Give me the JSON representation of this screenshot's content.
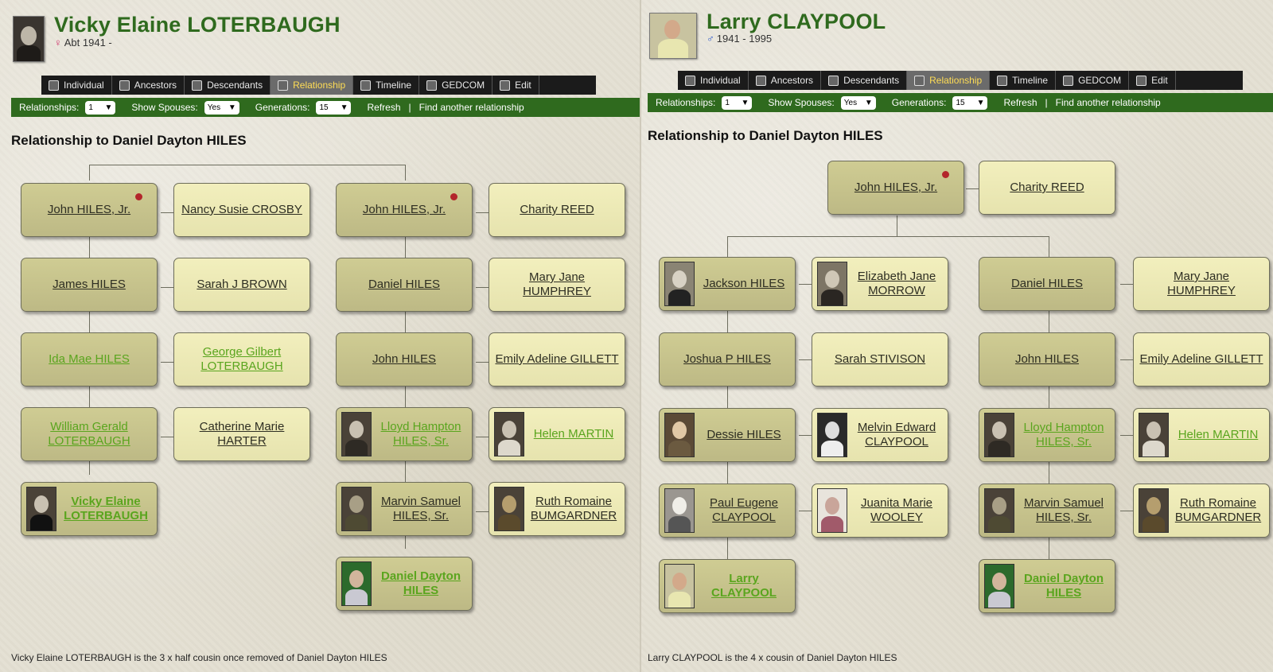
{
  "left": {
    "person": {
      "name": "Vicky Elaine LOTERBAUGH",
      "sex_symbol": "♀",
      "dates": "Abt 1941 -"
    },
    "tabs": [
      "Individual",
      "Ancestors",
      "Descendants",
      "Relationship",
      "Timeline",
      "GEDCOM",
      "Edit"
    ],
    "active_tab": "Relationship",
    "toolbar": {
      "relationships_label": "Relationships:",
      "relationships_value": "1",
      "spouses_label": "Show Spouses:",
      "spouses_value": "Yes",
      "generations_label": "Generations:",
      "generations_value": "15",
      "refresh": "Refresh",
      "separator": "|",
      "find": "Find another relationship"
    },
    "heading": "Relationship to Daniel Dayton HILES",
    "tree": {
      "col1": [
        {
          "name": "John HILES, Jr.",
          "spouse": "Nancy Susie CROSBY"
        },
        {
          "name": "James HILES",
          "spouse": "Sarah J BROWN"
        },
        {
          "name": "Ida Mae HILES",
          "spouse": "George Gilbert LOTERBAUGH"
        },
        {
          "name": "William Gerald LOTERBAUGH",
          "spouse": "Catherine Marie HARTER"
        },
        {
          "name": "Vicky Elaine LOTERBAUGH"
        }
      ],
      "col2": [
        {
          "name": "John HILES, Jr.",
          "spouse": "Charity REED"
        },
        {
          "name": "Daniel HILES",
          "spouse": "Mary Jane HUMPHREY"
        },
        {
          "name": "John HILES",
          "spouse": "Emily Adeline GILLETT"
        },
        {
          "name": "Lloyd Hampton HILES, Sr.",
          "spouse": "Helen MARTIN"
        },
        {
          "name": "Marvin Samuel HILES, Sr.",
          "spouse": "Ruth Romaine BUMGARDNER"
        },
        {
          "name": "Daniel Dayton HILES"
        }
      ]
    },
    "summary": "Vicky Elaine LOTERBAUGH is the 3 x half cousin once removed of Daniel Dayton HILES"
  },
  "right": {
    "person": {
      "name": "Larry CLAYPOOL",
      "sex_symbol": "♂",
      "dates": "1941 - 1995"
    },
    "tabs": [
      "Individual",
      "Ancestors",
      "Descendants",
      "Relationship",
      "Timeline",
      "GEDCOM",
      "Edit"
    ],
    "active_tab": "Relationship",
    "toolbar": {
      "relationships_label": "Relationships:",
      "relationships_value": "1",
      "spouses_label": "Show Spouses:",
      "spouses_value": "Yes",
      "generations_label": "Generations:",
      "generations_value": "15",
      "refresh": "Refresh",
      "separator": "|",
      "find": "Find another relationship"
    },
    "heading": "Relationship to Daniel Dayton HILES",
    "tree": {
      "top": {
        "name": "John HILES, Jr.",
        "spouse": "Charity REED"
      },
      "col1": [
        {
          "name": "Jackson HILES",
          "spouse": "Elizabeth Jane MORROW"
        },
        {
          "name": "Joshua P HILES",
          "spouse": "Sarah STIVISON"
        },
        {
          "name": "Dessie HILES",
          "spouse": "Melvin Edward CLAYPOOL"
        },
        {
          "name": "Paul Eugene CLAYPOOL",
          "spouse": "Juanita Marie WOOLEY"
        },
        {
          "name": "Larry CLAYPOOL"
        }
      ],
      "col2": [
        {
          "name": "Daniel HILES",
          "spouse": "Mary Jane HUMPHREY"
        },
        {
          "name": "John HILES",
          "spouse": "Emily Adeline GILLETT"
        },
        {
          "name": "Lloyd Hampton HILES, Sr.",
          "spouse": "Helen MARTIN"
        },
        {
          "name": "Marvin Samuel HILES, Sr.",
          "spouse": "Ruth Romaine BUMGARDNER"
        },
        {
          "name": "Daniel Dayton HILES"
        }
      ]
    },
    "summary": "Larry CLAYPOOL is the 4 x cousin of Daniel Dayton HILES"
  }
}
